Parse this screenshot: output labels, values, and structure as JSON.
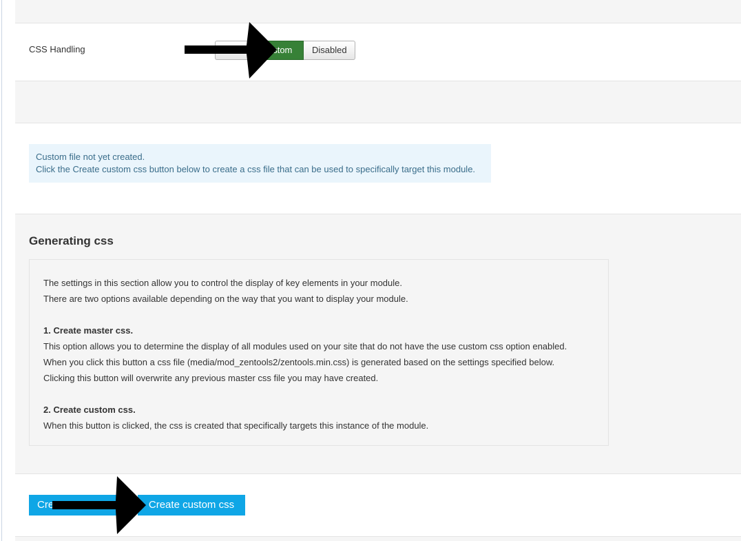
{
  "css_handling": {
    "label": "CSS Handling",
    "options": [
      "",
      "Custom",
      "Disabled"
    ],
    "selected": "Custom"
  },
  "notice": {
    "line1": "Custom file not yet created.",
    "line2": "Click the Create custom css button below to create a css file that can be used to specifically target this module."
  },
  "generating": {
    "title": "Generating css",
    "intro1": "The settings in this section allow you to control the display of key elements in your module.",
    "intro2": "There are two options available depending on the way that you want to display your module.",
    "master_heading": "1. Create master css.",
    "master_1": "This option allows you to determine the display of all modules used on your site that do not have the use custom css option enabled.",
    "master_2": "When you click this button a css file (media/mod_zentools2/zentools.min.css) is generated based on the settings specified below.",
    "master_3": "Clicking this button will overwrite any previous master css file you may have created.",
    "custom_heading": "2. Create custom css.",
    "custom_1": "When this button is clicked, the css is created that specifically targets this instance of the module."
  },
  "actions": {
    "master_label": "Cre",
    "custom_label": "Create custom css"
  },
  "colors": {
    "active_toggle": "#378137",
    "primary_button": "#0fa6e6",
    "notice_bg": "#eaf5fc",
    "annotation_arrow": "#000000"
  }
}
